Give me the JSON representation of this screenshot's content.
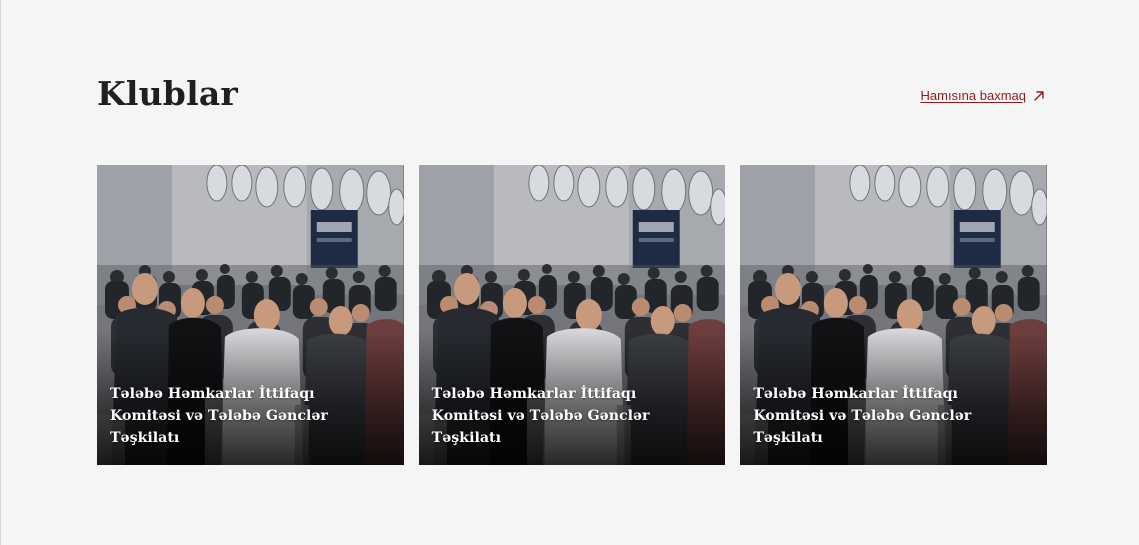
{
  "section": {
    "title": "Klublar",
    "see_all_label": "Hamısına baxmaq",
    "see_all_icon": "arrow-up-right-icon"
  },
  "cards": [
    {
      "title": "Tələbə Həmkarlar İttifaqı Komitəsi və Tələbə Gənclər Təşkilatı"
    },
    {
      "title": "Tələbə Həmkarlar İttifaqı Komitəsi və Tələbə Gənclər Təşkilatı"
    },
    {
      "title": "Tələbə Həmkarlar İttifaqı Komitəsi və Tələbə Gənclər Təşkilatı"
    }
  ],
  "colors": {
    "background": "#f5f5f5",
    "accent": "#8c1d1d",
    "title": "#1f1f1f"
  }
}
